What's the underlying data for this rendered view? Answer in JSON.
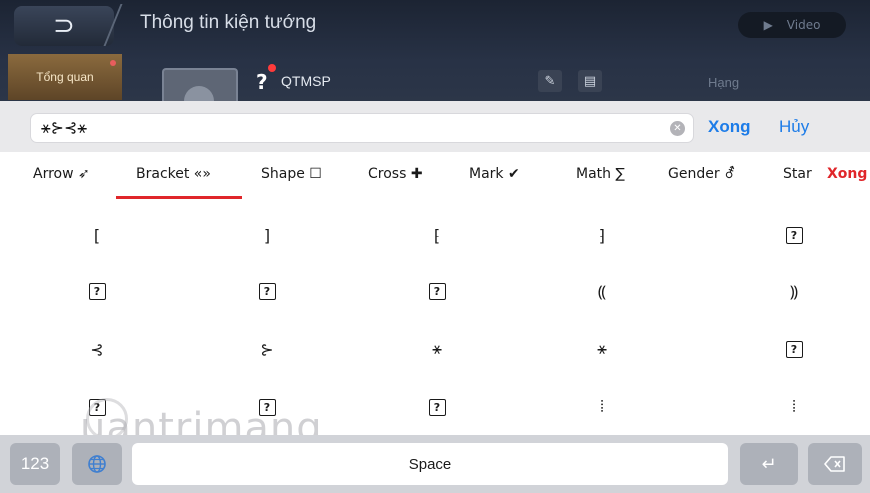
{
  "header": {
    "title": "Thông tin kiện tướng",
    "video_label": "Video",
    "overview_tab": "Tổng quan",
    "name_prefix": "?",
    "character_name": "QTMSP",
    "rank_label": "Hạng"
  },
  "input": {
    "value": "⚹⊱⊰⚹",
    "done_label": "Xong",
    "cancel_label": "Hủy"
  },
  "tabs": [
    {
      "label": "Arrow ➶"
    },
    {
      "label": "Bracket «»"
    },
    {
      "label": "Shape ☐"
    },
    {
      "label": "Cross ✚"
    },
    {
      "label": "Mark ✔"
    },
    {
      "label": "Math ∑"
    },
    {
      "label": "Gender ⚦"
    },
    {
      "label": "Star"
    }
  ],
  "active_tab": "Bracket «»",
  "tab_close_label": "Xong",
  "grid": [
    [
      "[",
      "]",
      "⁅",
      "⁆",
      "?"
    ],
    [
      "?",
      "?",
      "?",
      "⸨",
      "⸩"
    ],
    [
      "⊰",
      "⊱",
      "⚹",
      "⚹",
      "?"
    ],
    [
      "?",
      "?",
      "?",
      "⦙",
      "⦙"
    ]
  ],
  "watermark": "uantrimang",
  "keyboard": {
    "numbers_key": "123",
    "space_label": "Space",
    "return_key": "↵"
  },
  "colors": {
    "accent": "#1d7ce8",
    "active_tab_underline": "#e0262a",
    "header_bg": "#283246"
  }
}
